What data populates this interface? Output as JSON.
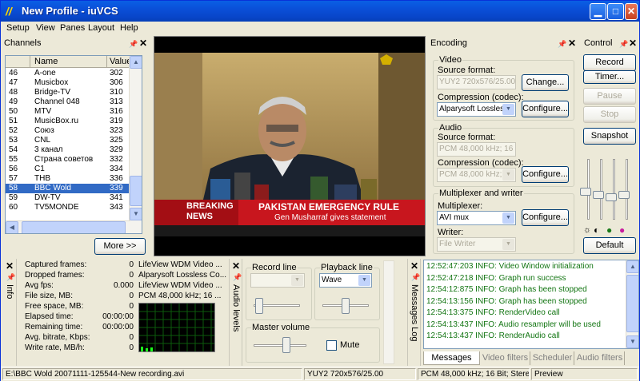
{
  "window": {
    "title": "New Profile - iuVCS"
  },
  "menu": [
    "Setup",
    "View",
    "Panes",
    "Layout",
    "Help"
  ],
  "channels": {
    "title": "Channels",
    "columns": [
      "Name",
      "Value"
    ],
    "rows": [
      {
        "num": "46",
        "name": "A-one",
        "value": "302"
      },
      {
        "num": "47",
        "name": "Musicbox",
        "value": "306"
      },
      {
        "num": "48",
        "name": "Bridge-TV",
        "value": "310"
      },
      {
        "num": "49",
        "name": "Channel 048",
        "value": "313"
      },
      {
        "num": "50",
        "name": "MTV",
        "value": "316"
      },
      {
        "num": "51",
        "name": "MusicBox.ru",
        "value": "319"
      },
      {
        "num": "52",
        "name": "Союз",
        "value": "323"
      },
      {
        "num": "53",
        "name": "CNL",
        "value": "325"
      },
      {
        "num": "54",
        "name": "3 канал",
        "value": "329"
      },
      {
        "num": "55",
        "name": "Страна советов",
        "value": "332"
      },
      {
        "num": "56",
        "name": "C1",
        "value": "334"
      },
      {
        "num": "57",
        "name": "THB",
        "value": "336"
      },
      {
        "num": "58",
        "name": "BBC Wold",
        "value": "339"
      },
      {
        "num": "59",
        "name": "DW-TV",
        "value": "341"
      },
      {
        "num": "60",
        "name": "TV5MONDE",
        "value": "343"
      }
    ],
    "selected_index": 12,
    "more_button": "More >>"
  },
  "video": {
    "breaking": "BREAKING",
    "news": "NEWS",
    "headline": "PAKISTAN EMERGENCY RULE",
    "subheadline": "Gen Musharraf gives statement"
  },
  "encoding": {
    "title": "Encoding",
    "video_group": "Video",
    "source_format_label": "Source format:",
    "video_source_format": "YUY2 720x576/25.00",
    "change_button": "Change...",
    "compression_label": "Compression (codec):",
    "video_codec": "Alparysoft Lossless",
    "configure_button": "Configure...",
    "audio_group": "Audio",
    "audio_source_format": "PCM 48,000 kHz; 16 B",
    "audio_codec": "PCM 48,000 kHz; 16",
    "mux_group": "Multiplexer and writer",
    "multiplexer_label": "Multiplexer:",
    "multiplexer": "AVI mux",
    "writer_label": "Writer:",
    "writer": "File Writer"
  },
  "control": {
    "title": "Control",
    "record": "Record",
    "timer": "Timer...",
    "pause": "Pause",
    "stop": "Stop",
    "snapshot": "Snapshot",
    "default": "Default",
    "slider_levels": [
      0.45,
      0.4,
      0.35,
      0.4
    ]
  },
  "info": {
    "tab": "Info",
    "rows": [
      {
        "label": "Captured frames:",
        "value": "0"
      },
      {
        "label": "Dropped frames:",
        "value": "0"
      },
      {
        "label": "Avg fps:",
        "value": "0.000"
      },
      {
        "label": "File size, MB:",
        "value": "0"
      },
      {
        "label": "Free space, MB:",
        "value": "0"
      },
      {
        "label": "Elapsed time:",
        "value": "00:00:00"
      },
      {
        "label": "Remaining time:",
        "value": "00:00:00"
      },
      {
        "label": "Avg. bitrate, Kbps:",
        "value": "0"
      },
      {
        "label": "Write rate, MB/h:",
        "value": "0"
      }
    ],
    "details": [
      "LifeView WDM Video ...",
      "Alparysoft Lossless Co...",
      "LifeView WDM Video ...",
      "PCM 48,000 kHz; 16 ..."
    ]
  },
  "audio_levels": {
    "tab": "Audio levels",
    "record_line": "Record line",
    "record_line_value": "",
    "playback_line": "Playback line",
    "playback_line_value": "Wave",
    "master_volume": "Master volume",
    "mute": "Mute"
  },
  "messages": {
    "tab": "Messages Log",
    "lines": [
      "12:52:47:203 INFO: Video Window initialization",
      "12:52:47:218 INFO: Graph run success",
      "12:54:12:875 INFO: Graph has been stopped",
      "12:54:13:156 INFO: Graph has been stopped",
      "12:54:13:375 INFO: RenderVideo call",
      "12:54:13:437 INFO: Audio resampler will be used",
      "12:54:13:437 INFO: RenderAudio call"
    ],
    "tabs": [
      "Messages Log",
      "Video filters",
      "Scheduler",
      "Audio filters"
    ]
  },
  "status": {
    "file": "E:\\BBC Wold 20071111-125544-New recording.avi",
    "video": "YUY2 720x576/25.00",
    "audio": "PCM 48,000 kHz; 16 Bit; Stereo",
    "mode": "Preview"
  },
  "colors": {
    "title_bar": "#0a4fd8",
    "selection": "#316ac5",
    "log_text": "#127512",
    "breaking_red": "#c8161e"
  }
}
